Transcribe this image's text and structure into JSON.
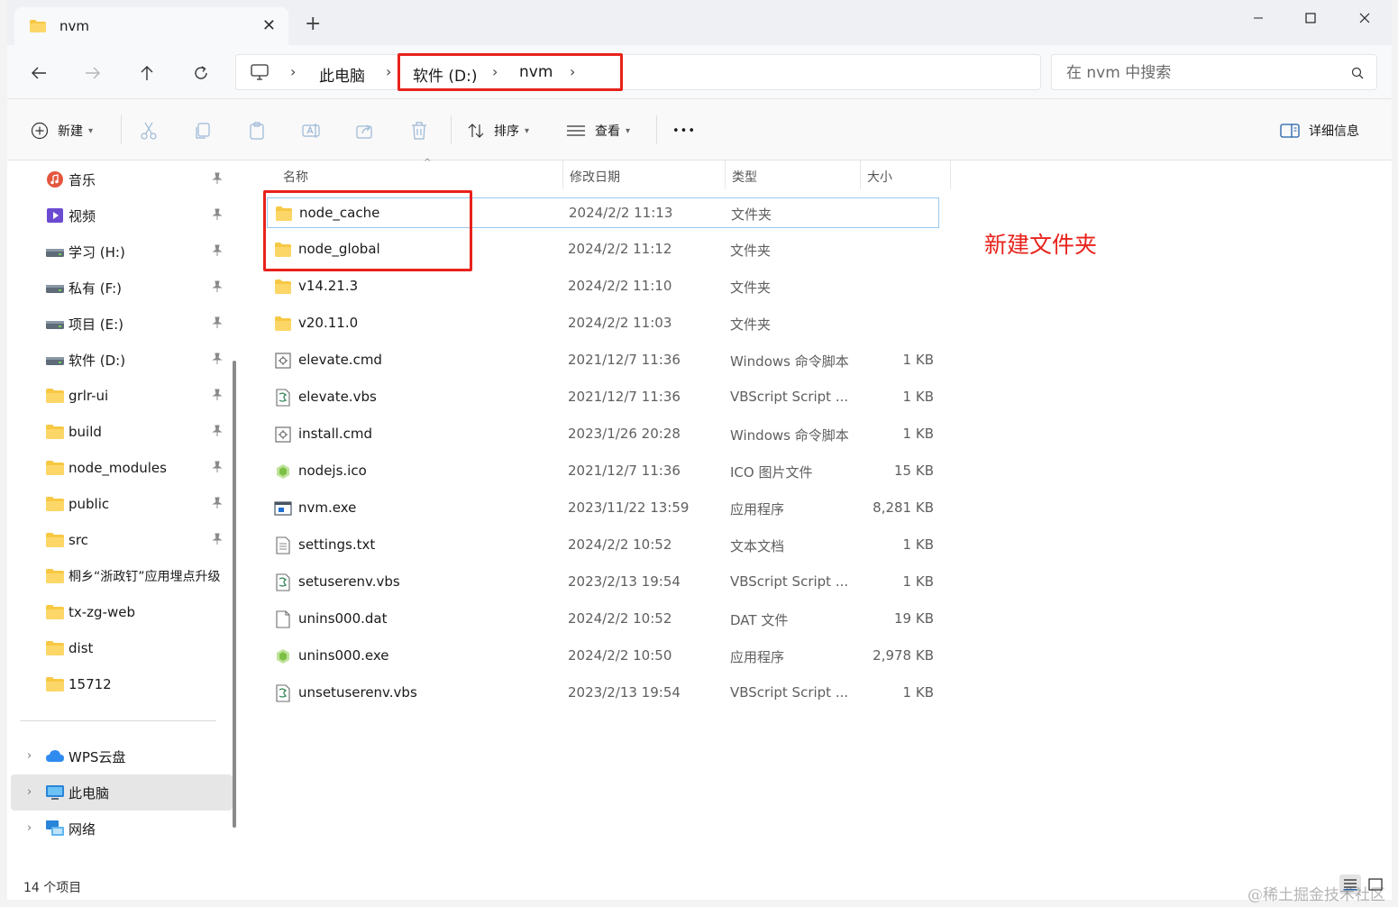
{
  "window": {
    "tab_title": "nvm",
    "new_tab": "+",
    "close_tab": "✕"
  },
  "address": {
    "crumbs": [
      "此电脑",
      "软件 (D:)",
      "nvm"
    ],
    "search_placeholder": "在 nvm 中搜索"
  },
  "toolbar": {
    "new_label": "新建",
    "sort_label": "排序",
    "view_label": "查看",
    "more_label": "•••",
    "details_label": "详细信息"
  },
  "sidebar": {
    "pinned": [
      {
        "label": "音乐",
        "icon": "music-icon"
      },
      {
        "label": "视频",
        "icon": "video-icon"
      },
      {
        "label": "学习 (H:)",
        "icon": "drive-icon"
      },
      {
        "label": "私有 (F:)",
        "icon": "drive-icon"
      },
      {
        "label": "项目 (E:)",
        "icon": "drive-icon"
      },
      {
        "label": "软件 (D:)",
        "icon": "drive-icon"
      },
      {
        "label": "grlr-ui",
        "icon": "folder-icon"
      },
      {
        "label": "build",
        "icon": "folder-icon"
      },
      {
        "label": "node_modules",
        "icon": "folder-icon"
      },
      {
        "label": "public",
        "icon": "folder-icon"
      },
      {
        "label": "src",
        "icon": "folder-icon"
      },
      {
        "label": "桐乡“浙政钉”应用埋点升级",
        "icon": "folder-icon"
      },
      {
        "label": "tx-zg-web",
        "icon": "folder-icon"
      },
      {
        "label": "dist",
        "icon": "folder-icon"
      },
      {
        "label": "15712",
        "icon": "folder-icon"
      }
    ],
    "roots": [
      {
        "label": "WPS云盘",
        "icon": "cloud-icon"
      },
      {
        "label": "此电脑",
        "icon": "computer-icon"
      },
      {
        "label": "网络",
        "icon": "network-icon"
      }
    ]
  },
  "columns": [
    "名称",
    "修改日期",
    "类型",
    "大小"
  ],
  "files": [
    {
      "name": "node_cache",
      "date": "2024/2/2 11:13",
      "type": "文件夹",
      "size": "",
      "icon": "folder-icon"
    },
    {
      "name": "node_global",
      "date": "2024/2/2 11:12",
      "type": "文件夹",
      "size": "",
      "icon": "folder-icon"
    },
    {
      "name": "v14.21.3",
      "date": "2024/2/2 11:10",
      "type": "文件夹",
      "size": "",
      "icon": "folder-icon"
    },
    {
      "name": "v20.11.0",
      "date": "2024/2/2 11:03",
      "type": "文件夹",
      "size": "",
      "icon": "folder-icon"
    },
    {
      "name": "elevate.cmd",
      "date": "2021/12/7 11:36",
      "type": "Windows 命令脚本",
      "size": "1 KB",
      "icon": "cmd-file-icon"
    },
    {
      "name": "elevate.vbs",
      "date": "2021/12/7 11:36",
      "type": "VBScript Script ...",
      "size": "1 KB",
      "icon": "vbs-file-icon"
    },
    {
      "name": "install.cmd",
      "date": "2023/1/26 20:28",
      "type": "Windows 命令脚本",
      "size": "1 KB",
      "icon": "cmd-file-icon"
    },
    {
      "name": "nodejs.ico",
      "date": "2021/12/7 11:36",
      "type": "ICO 图片文件",
      "size": "15 KB",
      "icon": "nodejs-icon"
    },
    {
      "name": "nvm.exe",
      "date": "2023/11/22 13:59",
      "type": "应用程序",
      "size": "8,281 KB",
      "icon": "exe-file-icon"
    },
    {
      "name": "settings.txt",
      "date": "2024/2/2 10:52",
      "type": "文本文档",
      "size": "1 KB",
      "icon": "text-file-icon"
    },
    {
      "name": "setuserenv.vbs",
      "date": "2023/2/13 19:54",
      "type": "VBScript Script ...",
      "size": "1 KB",
      "icon": "vbs-file-icon"
    },
    {
      "name": "unins000.dat",
      "date": "2024/2/2 10:52",
      "type": "DAT 文件",
      "size": "19 KB",
      "icon": "blank-file-icon"
    },
    {
      "name": "unins000.exe",
      "date": "2024/2/2 10:50",
      "type": "应用程序",
      "size": "2,978 KB",
      "icon": "nodejs-icon"
    },
    {
      "name": "unsetuserenv.vbs",
      "date": "2023/2/13 19:54",
      "type": "VBScript Script ...",
      "size": "1 KB",
      "icon": "vbs-file-icon"
    }
  ],
  "annotation": "新建文件夹",
  "status": {
    "item_count": "14 个项目"
  },
  "watermark": "@稀土掘金技术社区",
  "colors": {
    "highlight_red": "#e8221b",
    "folder_yellow": "#f7c844",
    "selection_border": "#99c9ef"
  }
}
